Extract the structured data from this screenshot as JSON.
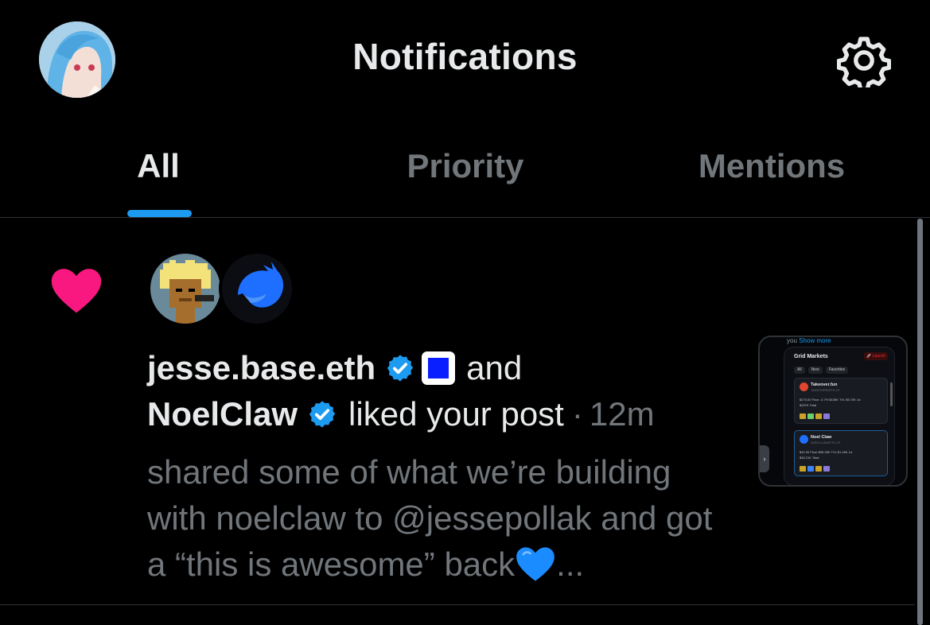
{
  "header": {
    "title": "Notifications",
    "icons": {
      "avatar": "user-avatar",
      "settings": "gear-icon"
    }
  },
  "tabs": [
    {
      "label": "All",
      "active": true
    },
    {
      "label": "Priority",
      "active": false
    },
    {
      "label": "Mentions",
      "active": false
    }
  ],
  "colors": {
    "accent": "#1d9bf0",
    "like": "#f91880",
    "text_primary": "#e7e9ea",
    "text_secondary": "#71767b",
    "background": "#000000"
  },
  "notification": {
    "type_icon": "heart-icon",
    "user1": "jesse.base.eth",
    "connector": "and",
    "user2": "NoelClaw",
    "action": "liked your post",
    "separator": "·",
    "time": "12m",
    "snippet": "shared some of what we’re building with noelclaw to @jessepollak and got a “this is awesome” back",
    "ellipsis": "...",
    "verified_icon": "verified-badge-icon",
    "thumbnail": {
      "top_text": "you",
      "show_more": "Show more",
      "app_title": "Grid Markets",
      "launch": "🚀 Launch",
      "chips": [
        "All",
        "New",
        "Favorites"
      ],
      "cards": [
        {
          "name": "Takeover.fun",
          "sub": "TAKEOVER/ETH LP",
          "stats": "$273.00 Floor -0.7%  $106K TVL  $5.73K 1d",
          "extra": "$157K Total"
        },
        {
          "name": "Noel Claw",
          "sub": "NOELCLAW/ETH LP",
          "stats": "$42.00 Floor  $35.28K TVL  $1.46K 1d",
          "extra": "$30.21K Total"
        }
      ]
    }
  }
}
